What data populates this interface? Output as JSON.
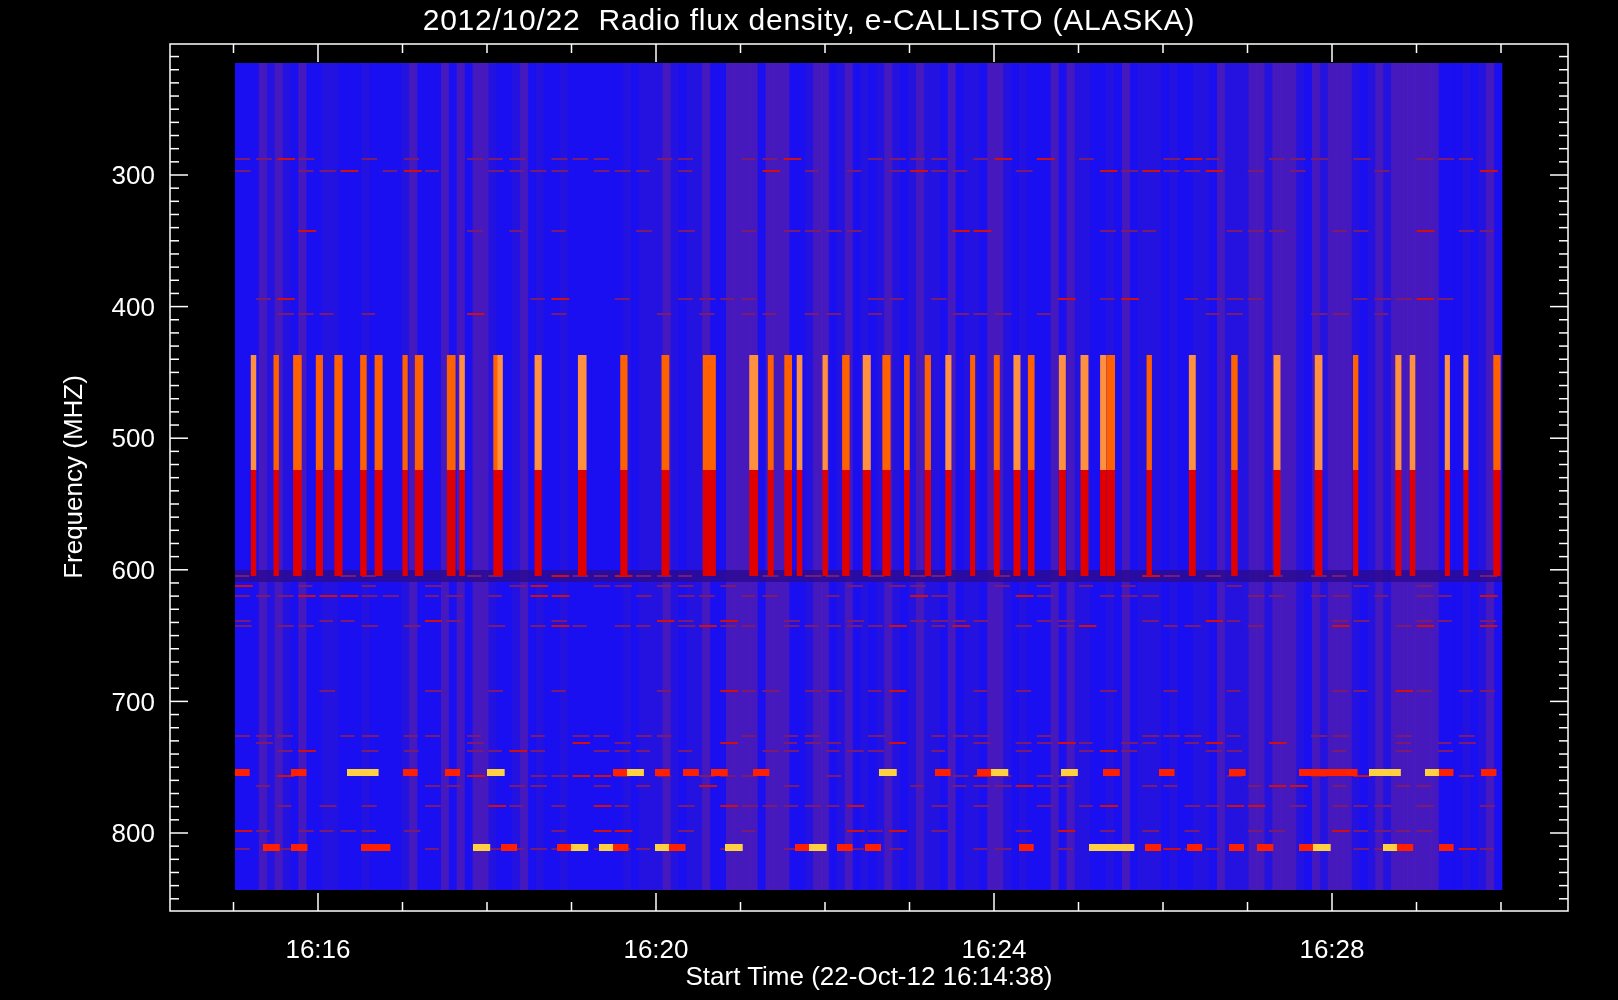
{
  "title": "2012/10/22  Radio flux density, e-CALLISTO (ALASKA)",
  "ylabel": "Frequency (MHZ)",
  "yticks": [
    "300",
    "400",
    "500",
    "600",
    "700",
    "800"
  ],
  "xticks": [
    "16:16",
    "16:20",
    "16:24",
    "16:28"
  ],
  "xlabel": "Start Time (22-Oct-12 16:14:38)"
}
